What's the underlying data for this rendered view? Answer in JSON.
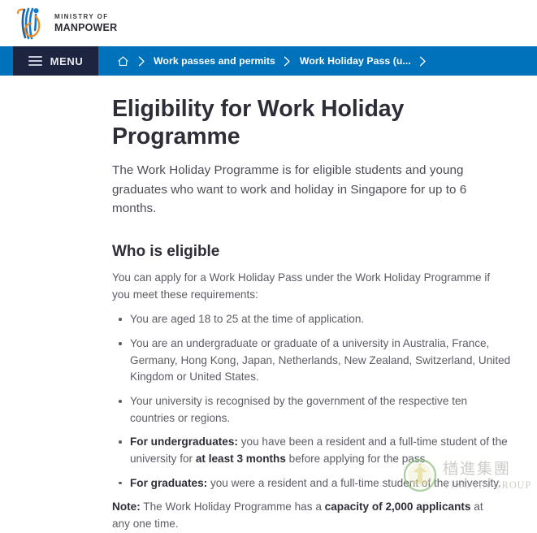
{
  "header": {
    "logo": {
      "icon_name": "ministry-of-manpower-logo",
      "line1": "MINISTRY OF",
      "line2": "MANPOWER",
      "colors": {
        "blue": "#0a74b9",
        "orange": "#f08a1e",
        "text": "#2b2b33"
      }
    }
  },
  "nav": {
    "background": "#0072bc",
    "menu_button": {
      "label": "MENU",
      "icon_name": "hamburger-icon",
      "background": "#1d2440"
    },
    "breadcrumb": [
      {
        "type": "home",
        "label": "",
        "icon_name": "home-icon"
      },
      {
        "type": "link",
        "label": "Work passes and permits"
      },
      {
        "type": "link",
        "label": "Work Holiday Pass (u..."
      }
    ],
    "separator_icon": "chevron-right-icon"
  },
  "main": {
    "title": "Eligibility for Work Holiday Programme",
    "intro": "The Work Holiday Programme is for eligible students and young graduates who want to work and holiday in Singapore for up to 6 months.",
    "section": {
      "heading": "Who is eligible",
      "lead": "You can apply for a Work Holiday Pass under the Work Holiday Programme if you meet these requirements:",
      "requirements": [
        {
          "bold_prefix": "",
          "text": "You are aged 18 to 25 at the time of application."
        },
        {
          "bold_prefix": "",
          "text": "You are an undergraduate or graduate of a university in Australia, France, Germany, Hong Kong, Japan, Netherlands, New Zealand, Switzerland, United Kingdom or United States."
        },
        {
          "bold_prefix": "",
          "text": "Your university is recognised by the government of the respective ten countries or regions."
        },
        {
          "bold_prefix": "For undergraduates:",
          "text_part1": " you have been a resident and a full-time student of the university for ",
          "bold_inline": "at least 3 months",
          "text_part2": " before applying for the pass."
        },
        {
          "bold_prefix": "For graduates:",
          "text": " you were a resident and a full-time student of the university."
        }
      ]
    },
    "note": {
      "bold_prefix": "Note:",
      "text_part1": " The Work Holiday Programme has a ",
      "bold_inline": "capacity of 2,000 applicants",
      "text_part2": " at any one time."
    }
  },
  "watermark": {
    "emblem_icon": "ying-jin-group-emblem",
    "chinese": "楢進集團",
    "english": "YING JIN GROUP",
    "color": "#b9bbb5",
    "emblem_ring_color": "#8ec07c"
  }
}
